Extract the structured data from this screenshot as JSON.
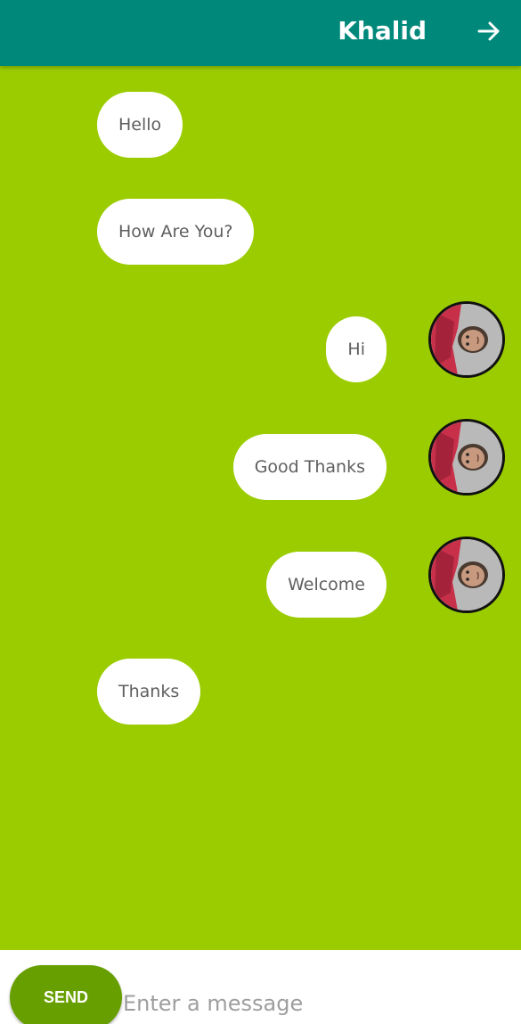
{
  "header": {
    "title": "Khalid",
    "action_icon": "arrow-forward-icon"
  },
  "messages": [
    {
      "text": "Hello",
      "side": "received"
    },
    {
      "text": "How Are You?",
      "side": "received"
    },
    {
      "text": "Hi",
      "side": "sent",
      "avatar": "user-avatar"
    },
    {
      "text": "Good Thanks",
      "side": "sent",
      "avatar": "user-avatar"
    },
    {
      "text": "Welcome",
      "side": "sent",
      "avatar": "user-avatar"
    },
    {
      "text": "Thanks",
      "side": "received"
    }
  ],
  "composer": {
    "send_label": "SEND",
    "placeholder": "Enter a message",
    "value": ""
  },
  "colors": {
    "header": "#00897b",
    "background": "#9acc00",
    "send_button": "#689f00",
    "bubble": "#ffffff"
  }
}
